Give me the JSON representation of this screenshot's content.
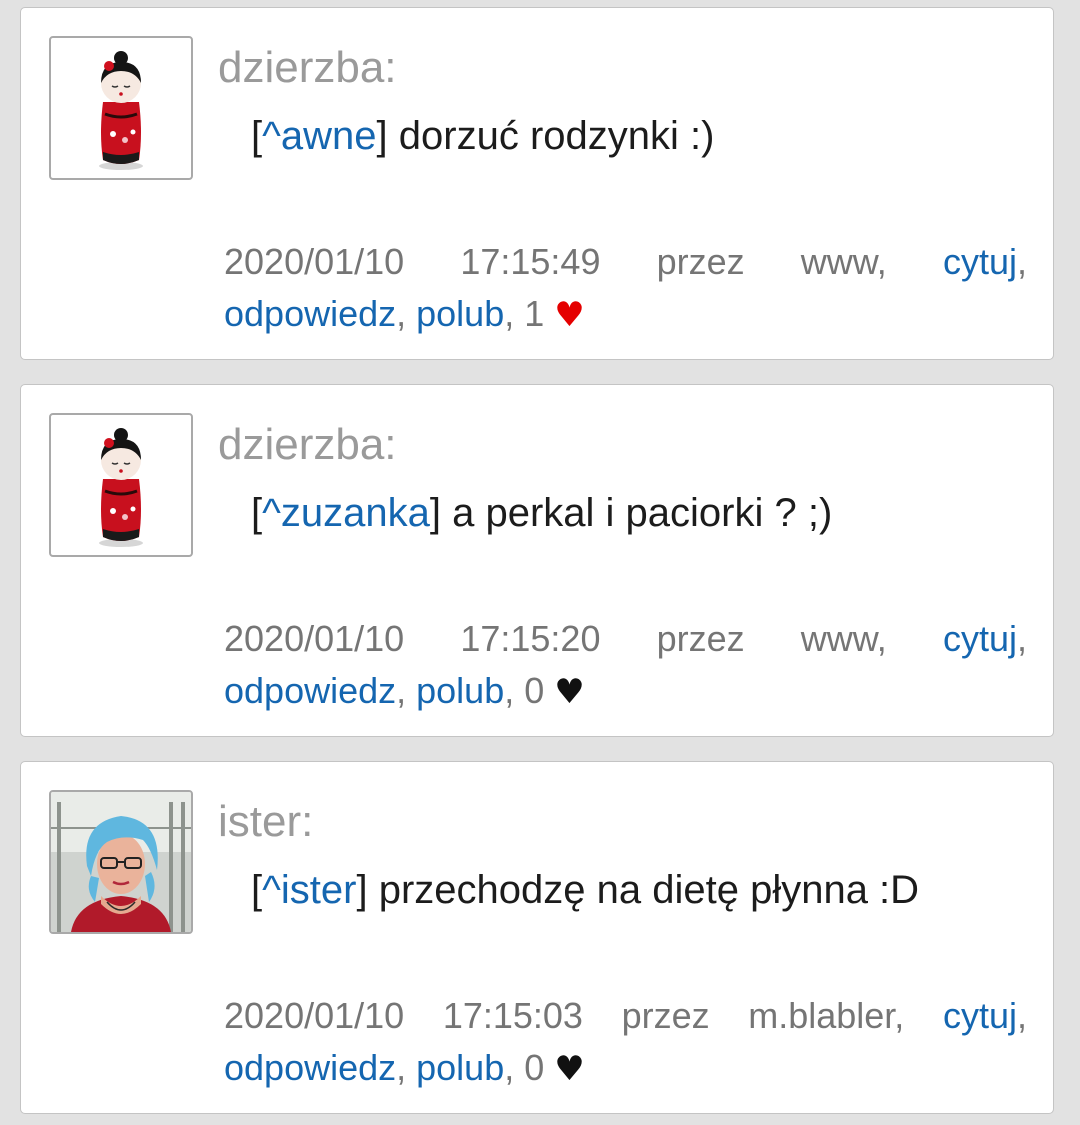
{
  "colors": {
    "background": "#e2e2e2",
    "card": "#ffffff",
    "author": "#9a9a9a",
    "link": "#1566b0",
    "meta": "#757575",
    "heart_liked": "#e50000",
    "heart_default": "#111111"
  },
  "posts": [
    {
      "avatar_icon": "kokeshi-doll-avatar",
      "author": "dzierzba:",
      "mention": "[^awne]",
      "mention_open": "[",
      "mention_name": "^awne",
      "mention_close": "]",
      "text": " dorzuć rodzynki :)",
      "date": "2020/01/10",
      "time": "17:15:49",
      "via_label": "przez",
      "via": "www,",
      "quote_label": "cytuj",
      "reply_label": "odpowiedz",
      "like_label": "polub",
      "likes": "1",
      "heart": "♥",
      "liked": true
    },
    {
      "avatar_icon": "kokeshi-doll-avatar",
      "author": "dzierzba:",
      "mention_open": "[",
      "mention_name": "^zuzanka",
      "mention_close": "]",
      "text": " a perkal i paciorki ? ;)",
      "date": "2020/01/10",
      "time": "17:15:20",
      "via_label": "przez",
      "via": "www,",
      "quote_label": "cytuj",
      "reply_label": "odpowiedz",
      "like_label": "polub",
      "likes": "0",
      "heart": "♥",
      "liked": false
    },
    {
      "avatar_icon": "woman-blue-hair-photo-avatar",
      "author": "ister:",
      "mention_open": "[",
      "mention_name": "^ister",
      "mention_close": "]",
      "text": " przechodzę na dietę płynna :D",
      "date": "2020/01/10",
      "time": "17:15:03",
      "via_label": "przez",
      "via": "m.blabler,",
      "quote_label": "cytuj",
      "reply_label": "odpowiedz",
      "like_label": "polub",
      "likes": "0",
      "heart": "♥",
      "liked": false
    }
  ]
}
